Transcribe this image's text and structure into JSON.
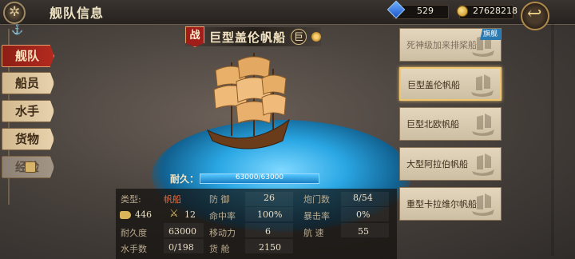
{
  "header": {
    "title": "舰队信息",
    "gems": "529",
    "coins": "27628218"
  },
  "side_menu": {
    "items": [
      {
        "label": "舰队",
        "active": true
      },
      {
        "label": "船员",
        "active": false
      },
      {
        "label": "水手",
        "active": false
      },
      {
        "label": "货物",
        "active": false
      },
      {
        "label": "经验",
        "active": false,
        "locked": true
      }
    ]
  },
  "ship": {
    "type_badge": "战",
    "name": "巨型盖伦帆船",
    "size_badge": "巨",
    "durability_label": "耐久：",
    "durability_text": "63000/63000",
    "durability_fraction": 1.0
  },
  "stats": {
    "type_label": "类型:",
    "type_value": "帆船",
    "cannon_value": "446",
    "swords_value": "12",
    "durability_label": "耐久度",
    "durability_value": "63000",
    "sailors_label": "水手数",
    "sailors_value": "0/198",
    "defense_label": "防 御",
    "defense_value": "26",
    "hit_label": "命中率",
    "hit_value": "100%",
    "move_label": "移动力",
    "move_value": "6",
    "cargo_label": "货 舱",
    "cargo_value": "2150",
    "gun_ports_label": "炮门数",
    "gun_ports_value": "8/54",
    "crit_label": "暴击率",
    "crit_value": "0%",
    "speed_label": "航 速",
    "speed_value": "55"
  },
  "fleet": {
    "flagship_tag": "旗舰",
    "ships": [
      {
        "label": "死神级加来排桨船",
        "selected": false,
        "faded": true
      },
      {
        "label": "巨型盖伦帆船",
        "selected": true,
        "faded": false
      },
      {
        "label": "巨型北欧帆船",
        "selected": false,
        "faded": false
      },
      {
        "label": "大型阿拉伯帆船",
        "selected": false,
        "faded": false
      },
      {
        "label": "重型卡拉维尔帆船",
        "selected": false,
        "faded": false
      }
    ]
  },
  "colors": {
    "active_tab": "#b32a1e",
    "water": "#2aa7e4",
    "flagship": "#2a7ab2"
  }
}
